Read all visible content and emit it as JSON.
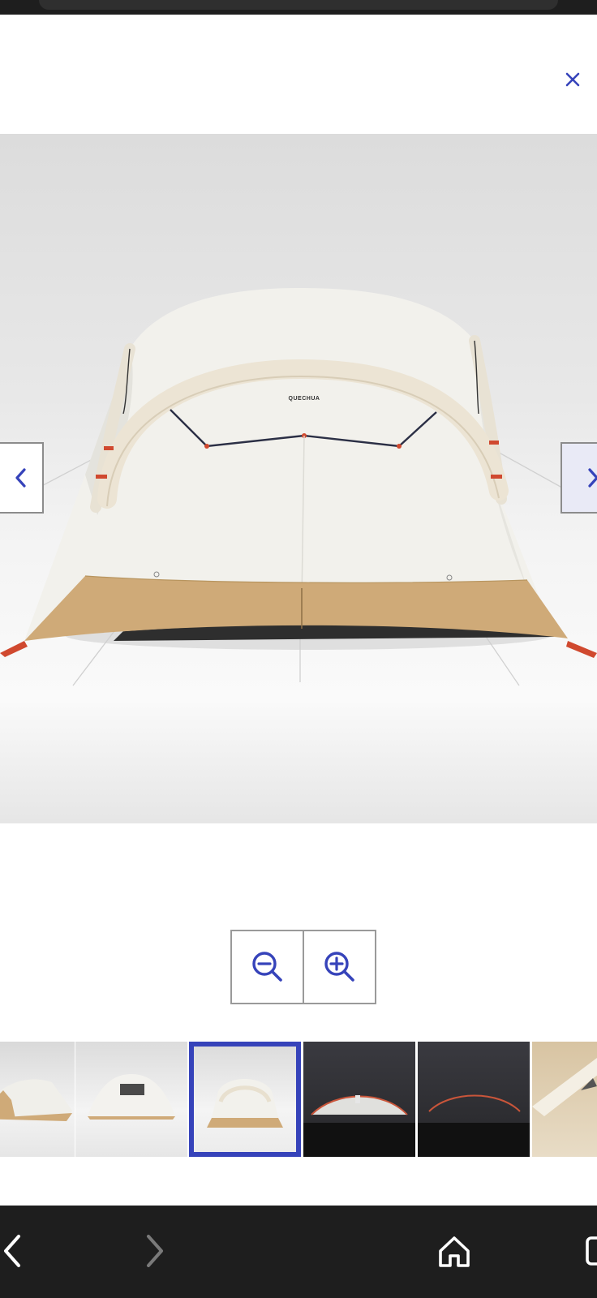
{
  "brand_label": "QUECHUA",
  "icons": {
    "close": "close-icon",
    "prev": "chevron-left-icon",
    "next": "chevron-right-icon",
    "zoom_out": "zoom-out-icon",
    "zoom_in": "zoom-in-icon",
    "nav_back": "back-icon",
    "nav_forward": "forward-icon",
    "nav_home": "home-icon",
    "nav_tabs": "tabs-icon"
  },
  "thumbnails": [
    {
      "name": "tent-side-view",
      "selected": false
    },
    {
      "name": "tent-front-window-view",
      "selected": false
    },
    {
      "name": "tent-rear-view",
      "selected": true
    },
    {
      "name": "tent-interior-lit",
      "selected": false
    },
    {
      "name": "tent-interior-dark",
      "selected": false
    },
    {
      "name": "tent-pole-detail",
      "selected": false
    }
  ],
  "colors": {
    "accent": "#3643ba",
    "tent_canvas": "#f2f1ec",
    "tent_skirt": "#cfaa78",
    "tent_pole": "#ece4d4",
    "bar_dark": "#1e1e1e"
  }
}
